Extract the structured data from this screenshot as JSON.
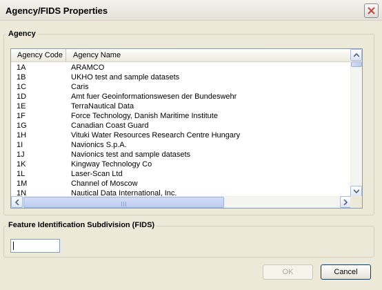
{
  "window": {
    "title": "Agency/FIDS Properties"
  },
  "agency_group": {
    "label": "Agency",
    "columns": [
      "Agency Code",
      "Agency Name"
    ],
    "rows": [
      {
        "code": "1A",
        "name": "ARAMCO"
      },
      {
        "code": "1B",
        "name": "UKHO test and sample datasets"
      },
      {
        "code": "1C",
        "name": "Caris"
      },
      {
        "code": "1D",
        "name": "Amt fuer Geoinformationswesen der Bundeswehr"
      },
      {
        "code": "1E",
        "name": "TerraNautical Data"
      },
      {
        "code": "1F",
        "name": "Force Technology, Danish Maritime Institute"
      },
      {
        "code": "1G",
        "name": "Canadian Coast Guard"
      },
      {
        "code": "1H",
        "name": "Vituki Water Resources Research Centre Hungary"
      },
      {
        "code": "1I",
        "name": "Navionics S.p.A."
      },
      {
        "code": "1J",
        "name": "Navionics test and sample datasets"
      },
      {
        "code": "1K",
        "name": "Kingway Technology Co"
      },
      {
        "code": "1L",
        "name": "Laser-Scan Ltd"
      },
      {
        "code": "1M",
        "name": "Channel of Moscow"
      },
      {
        "code": "1N",
        "name": "Nautical Data International, Inc."
      }
    ]
  },
  "fids_group": {
    "label": "Feature Identification Subdivision (FIDS)",
    "input_value": ""
  },
  "buttons": {
    "ok": "OK",
    "cancel": "Cancel"
  },
  "icons": {
    "close": "close-icon",
    "scroll_up": "chevron-up-icon",
    "scroll_down": "chevron-down-icon",
    "scroll_left": "chevron-left-icon",
    "scroll_right": "chevron-right-icon"
  },
  "colors": {
    "close_accent": "#c8452e",
    "list_border": "#7f9db9",
    "dialog_bg": "#ece9d8"
  }
}
